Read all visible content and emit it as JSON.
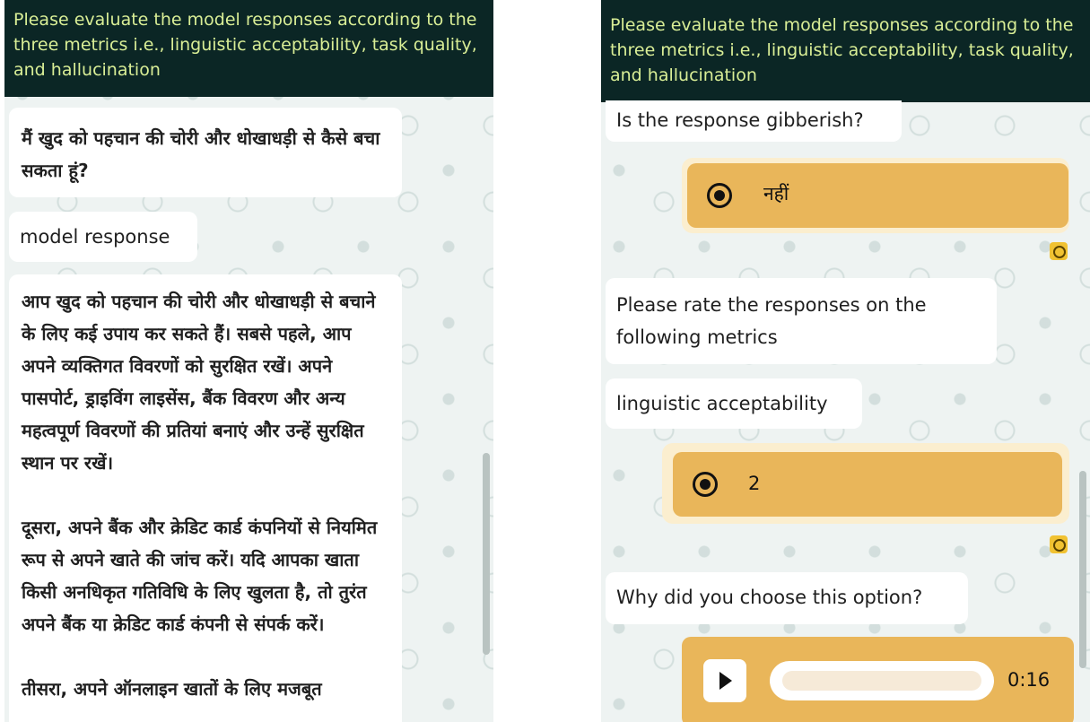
{
  "left": {
    "header": "Please evaluate the model responses according to the three metrics i.e., linguistic acceptability, task quality, and hallucination",
    "question": "मैं खुद को पहचान की चोरी और धोखाधड़ी से कैसे बचा सकता हूं?",
    "label": "model response",
    "response_p1": "आप खुद को पहचान की चोरी और धोखाधड़ी से बचाने के लिए कई उपाय कर सकते हैं। सबसे पहले, आप अपने व्यक्तिगत विवरणों को सुरक्षित रखें। अपने पासपोर्ट, ड्राइविंग लाइसेंस, बैंक विवरण और अन्य महत्वपूर्ण विवरणों की प्रतियां बनाएं और उन्हें सुरक्षित स्थान पर रखें।",
    "response_p2": "दूसरा, अपने बैंक और क्रेडिट कार्ड कंपनियों से नियमित रूप से अपने खाते की जांच करें। यदि आपका खाता किसी अनधिकृत गतिविधि के लिए खुलता है, तो तुरंत अपने बैंक या क्रेडिट कार्ड कंपनी से संपर्क करें।",
    "response_p3": "तीसरा, अपने ऑनलाइन खातों के लिए मजबूत"
  },
  "right": {
    "header": "Please evaluate the model responses according to the three metrics i.e., linguistic acceptability, task quality, and hallucination",
    "gibberish_question": "Is the response gibberish?",
    "gibberish_answer": "नहीं",
    "rate_prompt": "Please rate the responses on the following metrics",
    "metric_label": "linguistic acceptability",
    "metric_answer": "2",
    "why_prompt": "Why did you choose this option?",
    "audio_duration": "0:16"
  },
  "icons": {
    "clock": "clock-icon",
    "play": "play-icon",
    "radio": "radio-selected-icon"
  },
  "colors": {
    "header_bg": "#0b2625",
    "header_text": "#d9ee96",
    "answer_bg": "#e9b65a",
    "clock_bg": "#f1c232"
  }
}
